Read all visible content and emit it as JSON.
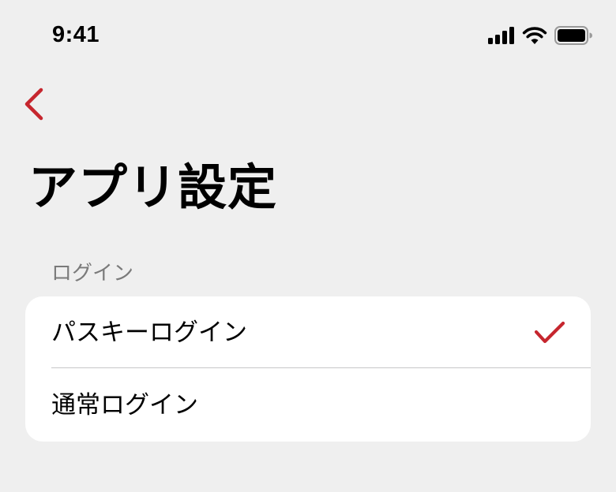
{
  "status_bar": {
    "time": "9:41"
  },
  "nav": {
    "back_icon": "chevron-left-icon"
  },
  "page": {
    "title": "アプリ設定"
  },
  "login_section": {
    "header": "ログイン",
    "options": [
      {
        "label": "パスキーログイン",
        "selected": true
      },
      {
        "label": "通常ログイン",
        "selected": false
      }
    ]
  },
  "colors": {
    "background": "#efefef",
    "card": "#ffffff",
    "accent": "#c6262e",
    "secondary_text": "#7a7a7a",
    "divider": "#c6c6c8"
  }
}
